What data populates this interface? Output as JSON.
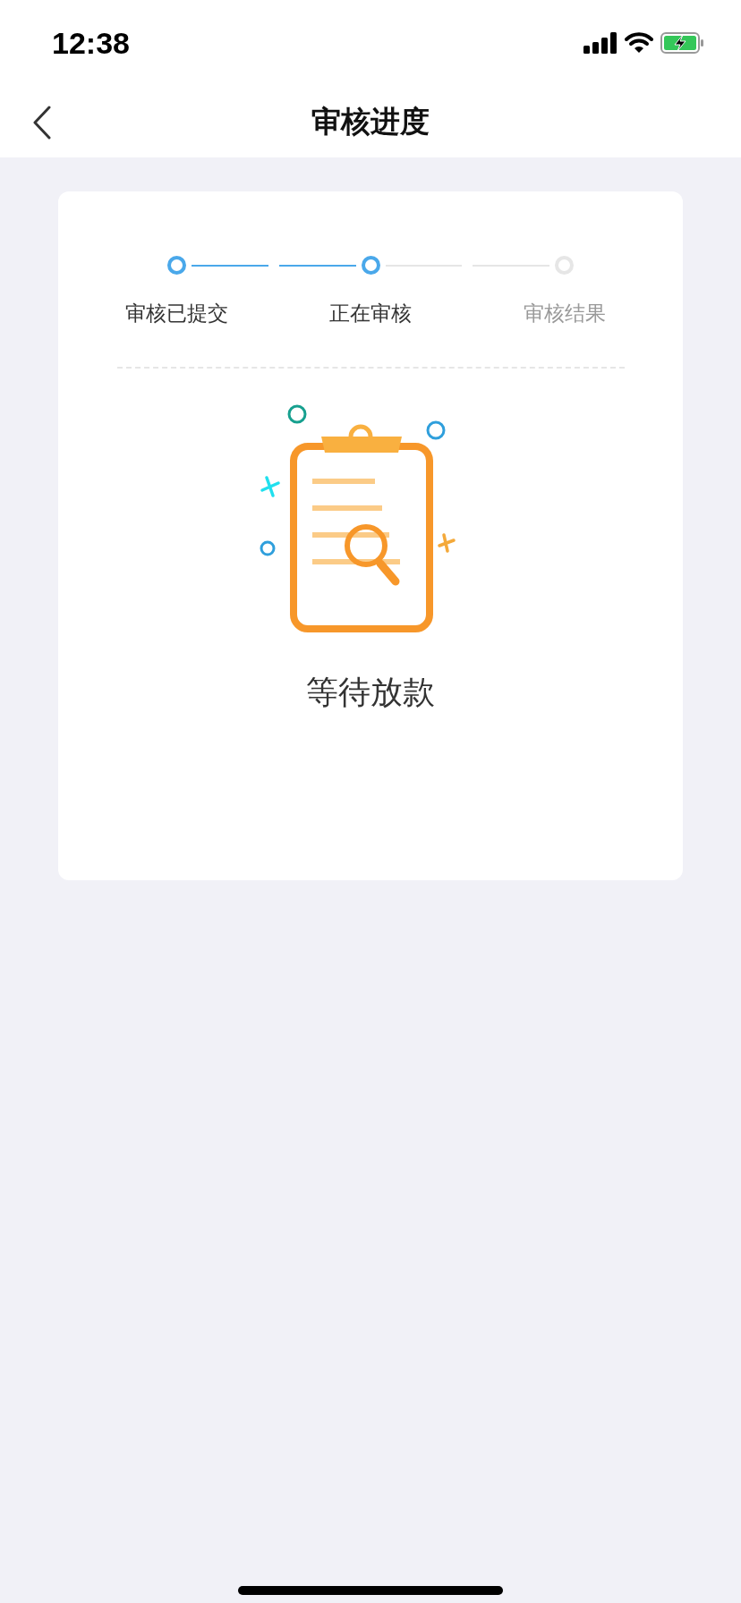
{
  "status_bar": {
    "time": "12:38"
  },
  "nav": {
    "title": "审核进度"
  },
  "steps": [
    {
      "label": "审核已提交",
      "reached": true
    },
    {
      "label": "正在审核",
      "reached": true
    },
    {
      "label": "审核结果",
      "reached": false
    }
  ],
  "status": {
    "text": "等待放款"
  }
}
